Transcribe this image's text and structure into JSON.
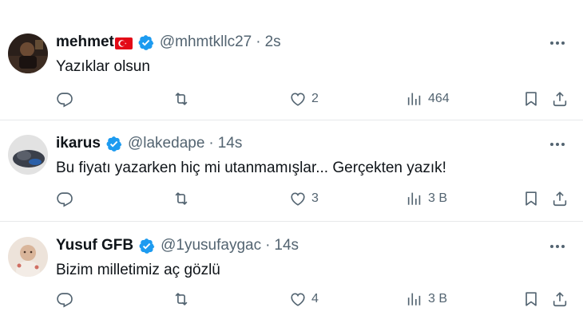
{
  "tweets": [
    {
      "name": "mehmet",
      "has_flag": true,
      "flag": "Turkey flag",
      "handle": "@mhmtkllc27",
      "separator": "·",
      "time": "2s",
      "text": "Yazıklar olsun",
      "likes": "2",
      "views": "464",
      "avatar_colors": [
        "#2a1f1a",
        "#6b4a33"
      ]
    },
    {
      "name": "ikarus",
      "has_flag": false,
      "handle": "@lakedape",
      "separator": "·",
      "time": "14s",
      "text": "Bu fiyatı yazarken hiç mi utanmamışlar... Gerçekten yazık!",
      "likes": "3",
      "views": "3 B",
      "avatar_colors": [
        "#d9d9d9",
        "#3a3f4a"
      ]
    },
    {
      "name": "Yusuf GFB",
      "has_flag": false,
      "handle": "@1yusufaygac",
      "separator": "·",
      "time": "14s",
      "text": "Bizim milletimiz aç gözlü",
      "likes": "4",
      "views": "3 B",
      "avatar_colors": [
        "#e9d6c9",
        "#b88d72"
      ]
    }
  ],
  "colors": {
    "verified": "#1d9bf0",
    "muted": "#536471",
    "text": "#0f1419",
    "divider": "#e7e9ea",
    "flag_red": "#e30a17"
  },
  "icons": [
    "reply-icon",
    "retweet-icon",
    "like-icon",
    "views-icon",
    "bookmark-icon",
    "share-icon",
    "more-icon",
    "verified-badge-icon"
  ]
}
